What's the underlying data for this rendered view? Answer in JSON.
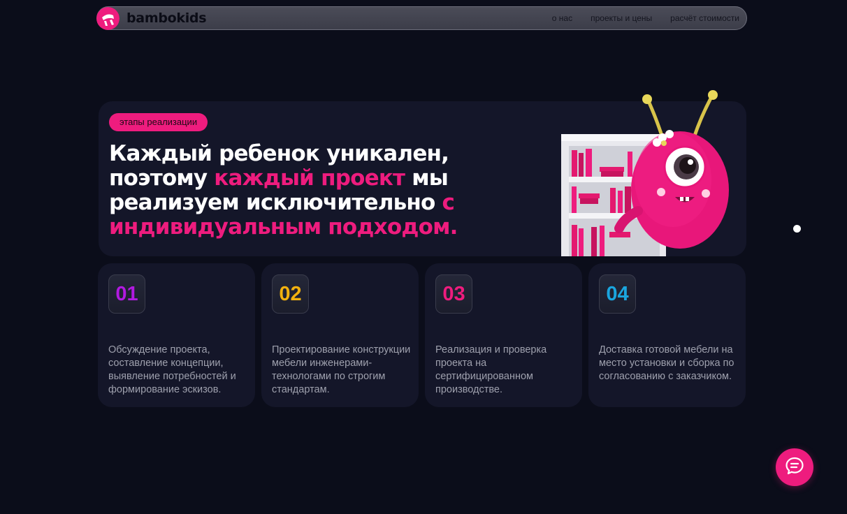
{
  "colors": {
    "background": "#0b0d1a",
    "card": "#141629",
    "accent": "#ee1c7e",
    "step_01": "#b11ae0",
    "step_02": "#f2b10f",
    "step_03": "#ee1c7e",
    "step_04": "#1aa5de"
  },
  "header": {
    "brand": "bambokids",
    "logo_icon": "bambokids-logo-icon",
    "nav": [
      {
        "label": "о нас"
      },
      {
        "label": "проекты и цены"
      },
      {
        "label": "расчёт стоимости"
      }
    ]
  },
  "hero": {
    "tag": "этапы реализации",
    "headline": {
      "part1": "Каждый ребенок уникален, поэтому ",
      "accent1": "каждый проект",
      "part2": " мы реализуем исключительно ",
      "accent2": "с индивидуальным подходом."
    },
    "illustration": "pink-monster-bookshelf-illustration"
  },
  "steps": [
    {
      "number": "01",
      "text": "Обсуждение проекта, составление концепции, выявление потребностей и формирование эскизов."
    },
    {
      "number": "02",
      "text": "Проектирование конструкции мебели инженерами-технологами по строгим стандартам."
    },
    {
      "number": "03",
      "text": "Реализация и проверка проекта на сертифицированном производстве."
    },
    {
      "number": "04",
      "text": "Доставка готовой мебели на место установки и сборка по согласованию с заказчиком."
    }
  ],
  "chat": {
    "icon": "chat-bubble-icon"
  }
}
